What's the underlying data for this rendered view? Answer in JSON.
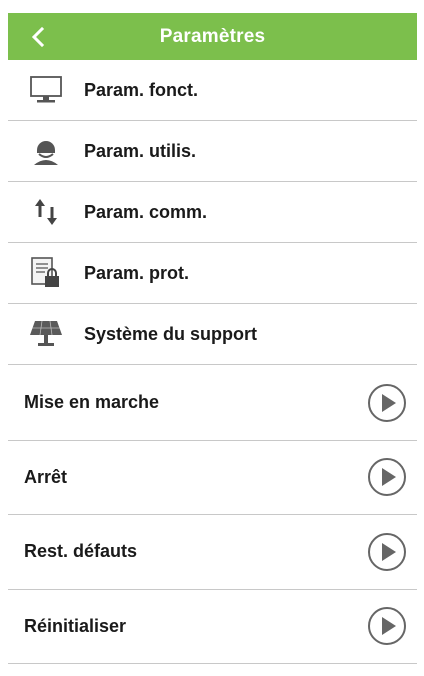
{
  "header": {
    "title": "Paramètres",
    "back_icon": "chevron-left-icon",
    "color": "#7cbf4c"
  },
  "menu": {
    "items": [
      {
        "label": "Param. fonct.",
        "icon": "monitor-icon"
      },
      {
        "label": "Param. utilis.",
        "icon": "user-icon"
      },
      {
        "label": "Param. comm.",
        "icon": "transfer-arrows-icon"
      },
      {
        "label": "Param. prot.",
        "icon": "locked-document-icon"
      },
      {
        "label": "Système du support",
        "icon": "solar-panel-icon"
      }
    ]
  },
  "actions": {
    "items": [
      {
        "label": "Mise en marche",
        "icon": "play-circle-icon"
      },
      {
        "label": "Arrêt",
        "icon": "play-circle-icon"
      },
      {
        "label": "Rest. défauts",
        "icon": "play-circle-icon"
      },
      {
        "label": "Réinitialiser",
        "icon": "play-circle-icon"
      }
    ]
  }
}
